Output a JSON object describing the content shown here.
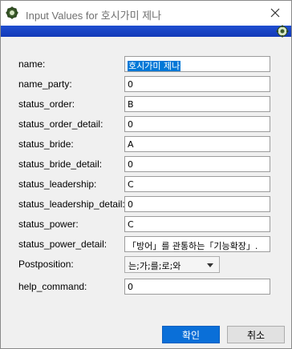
{
  "window": {
    "title": "Input Values for 호시가미 제나"
  },
  "form": {
    "rows": [
      {
        "label": "name:",
        "value": "호시가미 제나"
      },
      {
        "label": "name_party:",
        "value": "0"
      },
      {
        "label": "status_order:",
        "value": "B"
      },
      {
        "label": "status_order_detail:",
        "value": "0"
      },
      {
        "label": "status_bride:",
        "value": "A"
      },
      {
        "label": "status_bride_detail:",
        "value": "0"
      },
      {
        "label": "status_leadership:",
        "value": "C"
      },
      {
        "label": "status_leadership_detail:",
        "value": "0"
      },
      {
        "label": "status_power:",
        "value": "C"
      },
      {
        "label": "status_power_detail:",
        "value": "「방어」를 관통하는「기능확장」."
      },
      {
        "label": "Postposition:",
        "value": "는;가;를;로;와"
      },
      {
        "label": "help_command:",
        "value": "0"
      }
    ]
  },
  "buttons": {
    "ok": "확인",
    "cancel": "취소"
  },
  "colors": {
    "accent": "#0a6fd8",
    "title_bar_strip": "#1f4fd0",
    "selection": "#0078d7"
  },
  "icons": {
    "app": "gear-icon",
    "close": "close-icon",
    "bar": "gear-icon",
    "dropdown": "chevron-down-icon"
  }
}
